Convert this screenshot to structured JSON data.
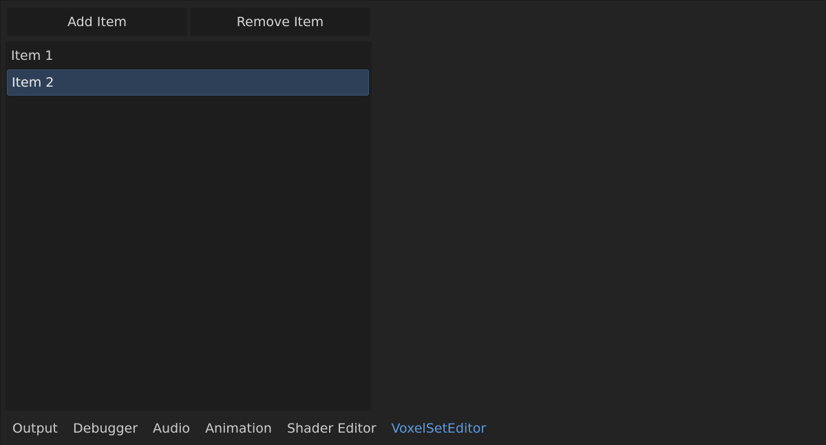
{
  "toolbar": {
    "add_label": "Add Item",
    "remove_label": "Remove Item"
  },
  "list": {
    "items": [
      {
        "label": "Item 1",
        "selected": false
      },
      {
        "label": "Item 2",
        "selected": true
      }
    ]
  },
  "bottom_tabs": [
    {
      "label": "Output",
      "active": false
    },
    {
      "label": "Debugger",
      "active": false
    },
    {
      "label": "Audio",
      "active": false
    },
    {
      "label": "Animation",
      "active": false
    },
    {
      "label": "Shader Editor",
      "active": false
    },
    {
      "label": "VoxelSetEditor",
      "active": true
    }
  ],
  "colors": {
    "background": "#232323",
    "panel": "#1d1d1d",
    "selection": "#2e4058",
    "active_tab": "#5e9be0"
  }
}
